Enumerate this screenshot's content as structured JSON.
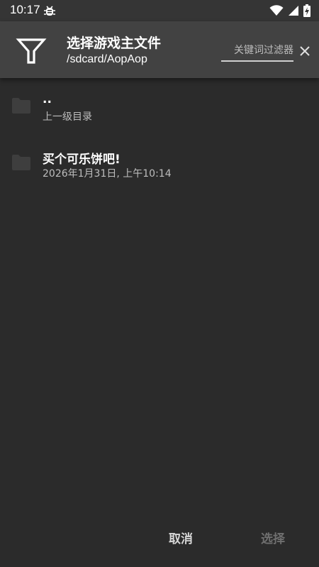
{
  "status_bar": {
    "time": "10:17"
  },
  "app_bar": {
    "title": "选择游戏主文件",
    "path": "/sdcard/AopAop",
    "filter_placeholder": "关键词过滤器",
    "filter_value": ""
  },
  "file_list": [
    {
      "name": "..",
      "detail": "上一级目录"
    },
    {
      "name": "买个可乐饼吧!",
      "detail": "2026年1月31日, 上午10:14"
    }
  ],
  "actions": {
    "cancel_label": "取消",
    "select_label": "选择"
  },
  "colors": {
    "background": "#2b2b2b",
    "app_bar": "#424242",
    "status_bar": "#353535",
    "folder_icon": "#3e3e3e",
    "disabled_text": "#6f6f6f"
  },
  "icons": {
    "filter": "filter-funnel-icon",
    "clear": "close-icon",
    "folder": "folder-icon",
    "bug": "bug-icon",
    "wifi": "wifi-icon",
    "signal": "signal-icon",
    "battery": "battery-charging-icon"
  }
}
